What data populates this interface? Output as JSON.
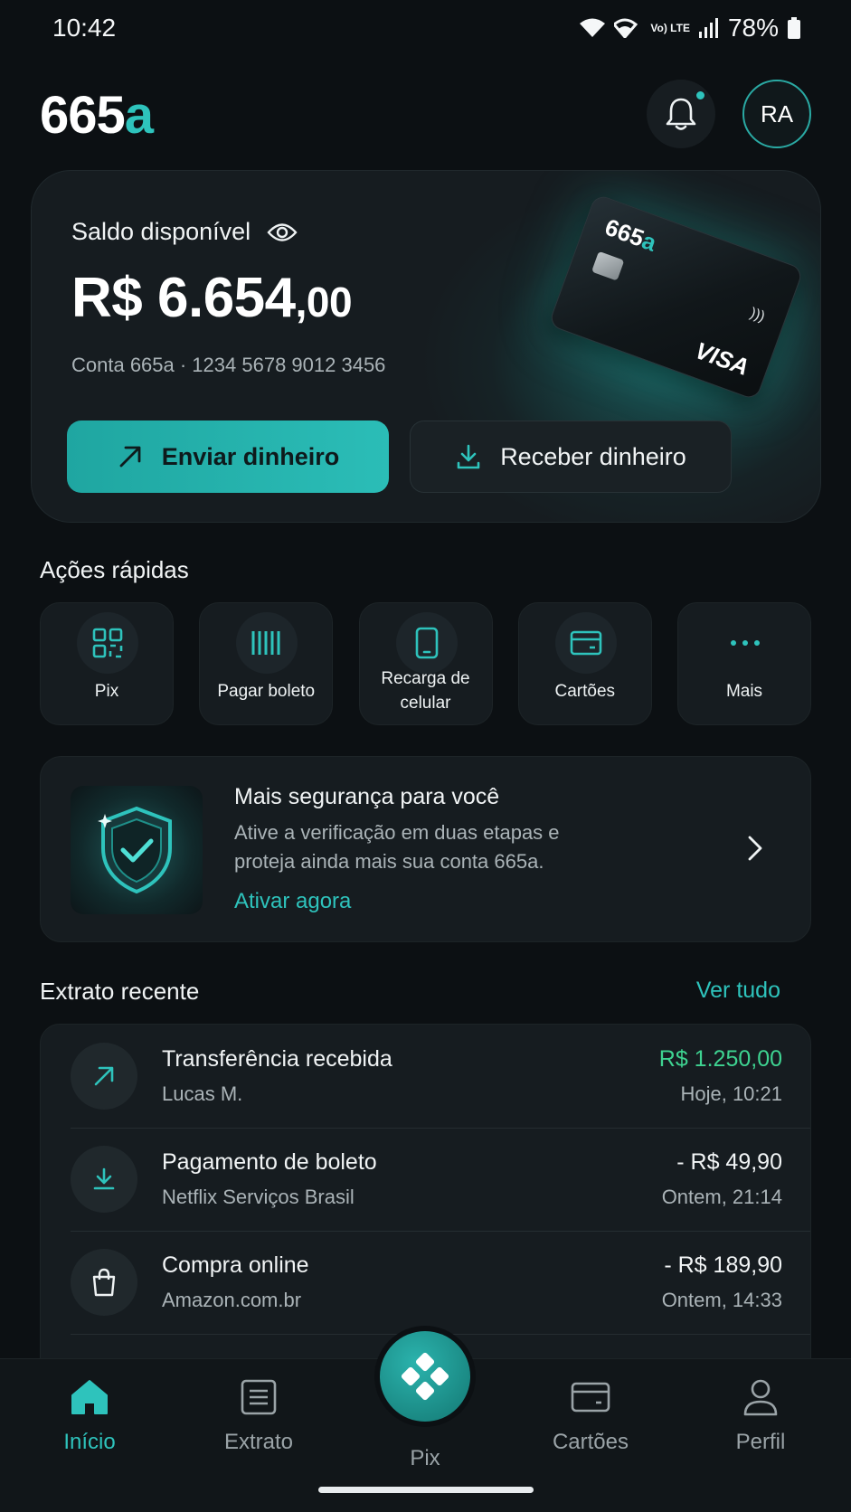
{
  "status_bar": {
    "time": "10:42",
    "battery": "78%",
    "volte": "Vo) LTE"
  },
  "header": {
    "logo_main": "665",
    "logo_accent": "a",
    "avatar_initials": "RA"
  },
  "balance": {
    "label": "Saldo disponível",
    "amount_main": "R$ 6.654",
    "amount_cents": ",00",
    "account": "Conta 665a · 1234 5678 9012 3456",
    "send_label": "Enviar dinheiro",
    "receive_label": "Receber dinheiro",
    "card": {
      "logo_main": "665",
      "logo_accent": "a",
      "brand": "VISA"
    }
  },
  "quick_actions": {
    "title": "Ações rápidas",
    "items": [
      {
        "label": "Pix",
        "icon": "qr-code-icon"
      },
      {
        "label": "Pagar boleto",
        "icon": "barcode-icon"
      },
      {
        "label": "Recarga de celular",
        "icon": "phone-icon"
      },
      {
        "label": "Cartões",
        "icon": "card-icon"
      },
      {
        "label": "Mais",
        "icon": "more-icon"
      }
    ]
  },
  "security": {
    "title": "Mais segurança para você",
    "description": "Ative a verificação em duas etapas e proteja ainda mais sua conta 665a.",
    "link": "Ativar agora"
  },
  "statement": {
    "title": "Extrato recente",
    "see_all": "Ver tudo",
    "items": [
      {
        "title": "Transferência recebida",
        "subtitle": "Lucas M.",
        "amount": "R$ 1.250,00",
        "time": "Hoje, 10:21",
        "positive": true
      },
      {
        "title": "Pagamento de boleto",
        "subtitle": "Netflix Serviços Brasil",
        "amount": "- R$ 49,90",
        "time": "Ontem, 21:14",
        "positive": false
      },
      {
        "title": "Compra online",
        "subtitle": "Amazon.com.br",
        "amount": "- R$ 189,90",
        "time": "Ontem, 14:33",
        "positive": false
      }
    ]
  },
  "bottom_nav": {
    "items": [
      {
        "label": "Início",
        "active": true
      },
      {
        "label": "Extrato",
        "active": false
      },
      {
        "label": "Pix",
        "active": false
      },
      {
        "label": "Cartões",
        "active": false
      },
      {
        "label": "Perfil",
        "active": false
      }
    ]
  },
  "colors": {
    "accent": "#2ec3bc",
    "positive": "#3ed391",
    "background": "#0c1013",
    "surface": "#161c20"
  }
}
